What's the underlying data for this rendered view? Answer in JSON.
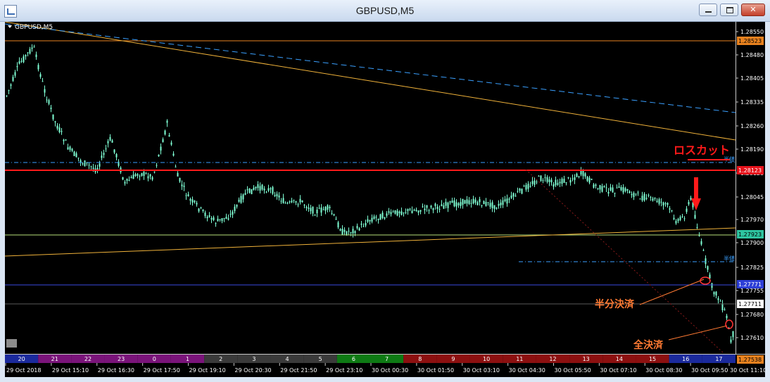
{
  "window": {
    "title": "GBPUSD,M5"
  },
  "chart_label": "GBPUSD,M5",
  "price_axis": {
    "ticks": [
      "1.28550",
      "1.28480",
      "1.28405",
      "1.28335",
      "1.28260",
      "1.28190",
      "1.28120",
      "1.28045",
      "1.27970",
      "1.27900",
      "1.27825",
      "1.27755",
      "1.27680",
      "1.27610"
    ],
    "tags": [
      {
        "text": "1.28523",
        "bg": "#e8821f",
        "fg": "#000000"
      },
      {
        "text": "1.28123",
        "bg": "#e6121b",
        "fg": "#ffffff"
      },
      {
        "text": "1.27923",
        "bg": "#2ec4a0",
        "fg": "#000000"
      },
      {
        "text": "1.27771",
        "bg": "#2d3fd6",
        "fg": "#ffffff"
      },
      {
        "text": "1.27711",
        "bg": "#ffffff",
        "fg": "#000000"
      },
      {
        "text": "1.27538",
        "bg": "#e8821f",
        "fg": "#000000"
      }
    ]
  },
  "session_bar": [
    {
      "label": "20",
      "color": "#1b2a9c"
    },
    {
      "label": "21",
      "color": "#7a147a"
    },
    {
      "label": "22",
      "color": "#7a147a"
    },
    {
      "label": "23",
      "color": "#7a147a"
    },
    {
      "label": "0",
      "color": "#7a147a"
    },
    {
      "label": "1",
      "color": "#7a147a"
    },
    {
      "label": "2",
      "color": "#3a3a3a"
    },
    {
      "label": "3",
      "color": "#3a3a3a"
    },
    {
      "label": "4",
      "color": "#3a3a3a"
    },
    {
      "label": "5",
      "color": "#3a3a3a"
    },
    {
      "label": "6",
      "color": "#0e7a14"
    },
    {
      "label": "7",
      "color": "#0e7a14"
    },
    {
      "label": "8",
      "color": "#8c1010"
    },
    {
      "label": "9",
      "color": "#8c1010"
    },
    {
      "label": "10",
      "color": "#8c1010"
    },
    {
      "label": "11",
      "color": "#8c1010"
    },
    {
      "label": "12",
      "color": "#8c1010"
    },
    {
      "label": "13",
      "color": "#8c1010"
    },
    {
      "label": "14",
      "color": "#8c1010"
    },
    {
      "label": "15",
      "color": "#8c1010"
    },
    {
      "label": "16",
      "color": "#1b2a9c"
    },
    {
      "label": "17",
      "color": "#1b2a9c"
    }
  ],
  "time_axis": [
    "29 Oct 2018",
    "29 Oct 15:10",
    "29 Oct 16:30",
    "29 Oct 17:50",
    "29 Oct 19:10",
    "29 Oct 20:30",
    "29 Oct 21:50",
    "29 Oct 23:10",
    "30 Oct 00:30",
    "30 Oct 01:50",
    "30 Oct 03:10",
    "30 Oct 04:30",
    "30 Oct 05:50",
    "30 Oct 07:10",
    "30 Oct 08:30",
    "30 Oct 09:50",
    "30 Oct 11:10"
  ],
  "annotations": {
    "loss_cut": "ロスカット",
    "half_settle": "半分決済",
    "full_settle": "全決済",
    "half_tag_1": "半値",
    "half_tag_2": "半値"
  },
  "colors": {
    "background": "#000000",
    "candle": "#7fffd4",
    "losscut_line": "#ff1a1a",
    "annotation_orange": "#ff7a33",
    "trend_orange": "#f0b23a",
    "trend_blue": "#3aa0ff"
  }
}
